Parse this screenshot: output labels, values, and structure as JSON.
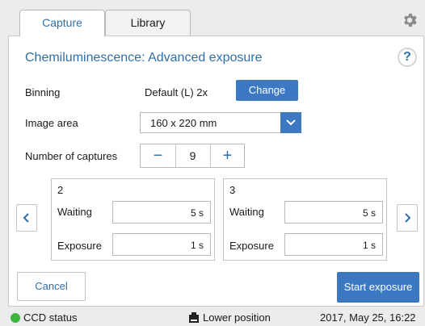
{
  "tabs": [
    {
      "label": "Capture",
      "active": true
    },
    {
      "label": "Library",
      "active": false
    }
  ],
  "icons": {
    "settings": "gear-icon",
    "help": "help-icon"
  },
  "help_label": "?",
  "title": "Chemiluminescence: Advanced exposure",
  "binning": {
    "label": "Binning",
    "value": "Default (L) 2x",
    "button_label": "Change"
  },
  "image_area": {
    "label": "Image area",
    "selected": "160 x 220 mm"
  },
  "captures": {
    "label": "Number of captures",
    "minus": "−",
    "count": "9",
    "plus": "+"
  },
  "capture_cards": [
    {
      "number": "2",
      "waiting_label": "Waiting",
      "waiting_value": "5 s",
      "exposure_label": "Exposure",
      "exposure_value": "1 s"
    },
    {
      "number": "3",
      "waiting_label": "Waiting",
      "waiting_value": "5 s",
      "exposure_label": "Exposure",
      "exposure_value": "1 s"
    }
  ],
  "actions": {
    "cancel": "Cancel",
    "start": "Start exposure"
  },
  "status": {
    "ccd": "CCD status",
    "ccd_color": "#3db43d",
    "position": "Lower position",
    "datetime": "2017, May 25, 16:22"
  },
  "colors": {
    "accent": "#3d79c3",
    "title": "#2f6fa9"
  }
}
